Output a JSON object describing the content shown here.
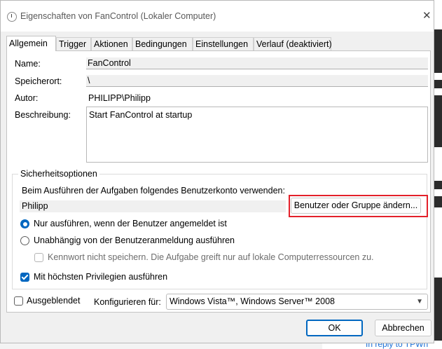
{
  "window": {
    "title": "Eigenschaften von FanControl (Lokaler Computer)",
    "close_glyph": "✕"
  },
  "tabs": [
    {
      "label": "Allgemein",
      "active": true
    },
    {
      "label": "Trigger"
    },
    {
      "label": "Aktionen"
    },
    {
      "label": "Bedingungen"
    },
    {
      "label": "Einstellungen"
    },
    {
      "label": "Verlauf (deaktiviert)"
    }
  ],
  "general": {
    "name_label": "Name:",
    "name_value": "FanControl",
    "location_label": "Speicherort:",
    "location_value": "\\",
    "author_label": "Autor:",
    "author_value": "PHILIPP\\Philipp",
    "description_label": "Beschreibung:",
    "description_value": "Start FanControl at startup"
  },
  "security": {
    "group_title": "Sicherheitsoptionen",
    "account_prompt": "Beim Ausführen der Aufgaben folgendes Benutzerkonto verwenden:",
    "user_value": "Philipp",
    "change_user_button": "Benutzer oder Gruppe ändern...",
    "radio_logged_on": "Nur ausführen, wenn der Benutzer angemeldet ist",
    "radio_independent": "Unabhängig von der Benutzeranmeldung ausführen",
    "no_store_password": "Kennwort nicht speichern. Die Aufgabe greift nur auf lokale Computerressourcen zu.",
    "highest_privileges": "Mit höchsten Privilegien ausführen",
    "highlight_color": "#e3202a",
    "accent_color": "#0067c0"
  },
  "footer": {
    "hidden_label": "Ausgeblendet",
    "configure_label": "Konfigurieren für:",
    "configure_value": "Windows Vista™, Windows Server™ 2008",
    "ok_button": "OK",
    "cancel_button": "Abbrechen"
  },
  "background": {
    "link_text": "In reply to TPWh"
  }
}
